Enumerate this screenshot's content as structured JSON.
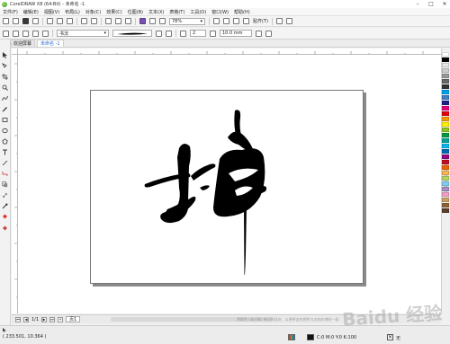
{
  "titlebar": {
    "title": "CorelDRAW X8 (64-Bit) - 未命名 -1",
    "controls": {
      "minimize": "–",
      "maximize": "□",
      "close": "✕"
    }
  },
  "menubar": {
    "items": [
      "文件(F)",
      "编辑(E)",
      "视图(V)",
      "布局(L)",
      "对象(C)",
      "效果(C)",
      "位图(B)",
      "文本(X)",
      "表格(T)",
      "工具(O)",
      "窗口(W)",
      "帮助(H)"
    ]
  },
  "std_toolbar": {
    "zoom": "78%",
    "snap_label": "贴齐(T)",
    "dropdown_arrow": "▾"
  },
  "prop_bar": {
    "preset": "书法",
    "width_steps": "2",
    "stroke_width": "10.0 mm",
    "arrow": "▾"
  },
  "doc_tabs": {
    "home": "欢迎屏幕",
    "document": "未命名 -1"
  },
  "page_nav": {
    "count": "1/1",
    "page_tab": "页1",
    "palette_hint": "将颜色 (或对象) 拖动到此处，以便将这些颜色与文档存储在一起"
  },
  "status": {
    "coords": "( 233.501, 10.364 )",
    "fill": "C:0 M:0 Y:0 K:100",
    "outline": "无"
  },
  "watermark": "Baidu 经验",
  "palette": [
    "#ffffff",
    "#000000",
    "#e6e6e6",
    "#cccccc",
    "#999999",
    "#666666",
    "#333333",
    "#00a0e9",
    "#3b7fc4",
    "#1d2088",
    "#e4007f",
    "#e60012",
    "#f39800",
    "#fff100",
    "#8fc31f",
    "#009944",
    "#00a29a",
    "#00b7ee",
    "#0068b7",
    "#920783",
    "#c30d23",
    "#eb6100",
    "#f8b551",
    "#b3d465",
    "#7ecef4",
    "#a48ec2",
    "#f19ec2",
    "#c9a063",
    "#8c6239",
    "#5a3d2b"
  ],
  "colors": {
    "accent": "#2a6fd1",
    "ink": "#000000"
  }
}
